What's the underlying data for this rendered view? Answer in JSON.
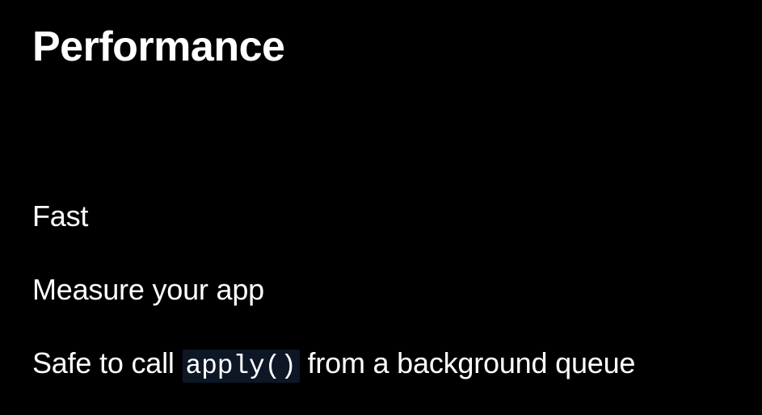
{
  "heading": "Performance",
  "bullets": {
    "b0": "Fast",
    "b1": "Measure your app",
    "b2_prefix": "Safe to call ",
    "b2_code": "apply()",
    "b2_suffix": " from a background queue"
  }
}
